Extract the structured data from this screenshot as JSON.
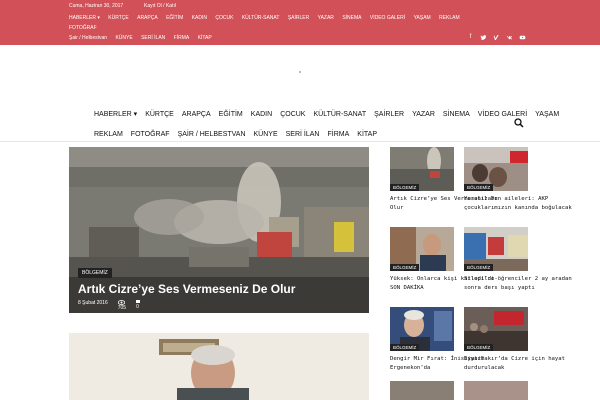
{
  "topbar": {
    "date": "Cuma, Haziran 30, 2017",
    "login": "Kayıt Ol / Katıl",
    "nav": [
      "HABERLER ▾",
      "KÜRTÇE",
      "ARAPÇA",
      "EĞİTİM",
      "KADIN",
      "ÇOCUK",
      "KÜLTÜR-SANAT",
      "ŞAİRLER",
      "YAZAR",
      "SİNEMA",
      "VİDEO GALERİ",
      "YAŞAM",
      "REKLAM",
      "FOTOĞRAF",
      "Şair / Helbestvan",
      "KÜNYE",
      "SERİ İLAN",
      "FİRMA",
      "KİTAP"
    ],
    "social": [
      "f",
      "t",
      "v",
      "vk",
      "yt"
    ]
  },
  "mainnav": {
    "row1": [
      "HABERLER ▾",
      "KÜRTÇE",
      "ARAPÇA",
      "EĞİTİM",
      "KADIN",
      "ÇOCUK",
      "KÜLTÜR-SANAT",
      "ŞAİRLER",
      "YAZAR",
      "SİNEMA",
      "VİDEO GALERİ",
      "YAŞAM"
    ],
    "row2": [
      "REKLAM",
      "FOTOĞRAF",
      "ŞAİR / HELBESTVAN",
      "KÜNYE",
      "SERİ İLAN",
      "FİRMA",
      "KİTAP"
    ]
  },
  "featured": {
    "category": "BÖLGEMİZ",
    "title": "Artık Cizre’ye Ses Vermeseniz De Olur",
    "date": "8 Şubat 2016",
    "views": "705",
    "comments": "0"
  },
  "cards": [
    {
      "badge": "BÖLGEMİZ",
      "title": "Artık Cizre’ye Ses Vermeseniz De Olur"
    },
    {
      "badge": "BÖLGEMİZ",
      "title": "Yaralıların aileleri: AKP çocuklarımızın kanında boğulacak"
    },
    {
      "badge": "BÖLGEMİZ",
      "title": "Yüksek: Onlarca kişi katledildi-SON DAKİKA"
    },
    {
      "badge": "BÖLGEMİZ",
      "title": "Silopi’de öğrenciler 2 ay aradan sonra ders başı yaptı"
    },
    {
      "badge": "BÖLGEMİZ",
      "title": "Dengir Mir Fırat: İnisiyatif Ergenekon’da"
    },
    {
      "badge": "BÖLGEMİZ",
      "title": "Diyarbakır’da Cizre için hayat durdurulacak"
    }
  ],
  "colors": {
    "brand": "#d25057",
    "dark": "#222222"
  }
}
